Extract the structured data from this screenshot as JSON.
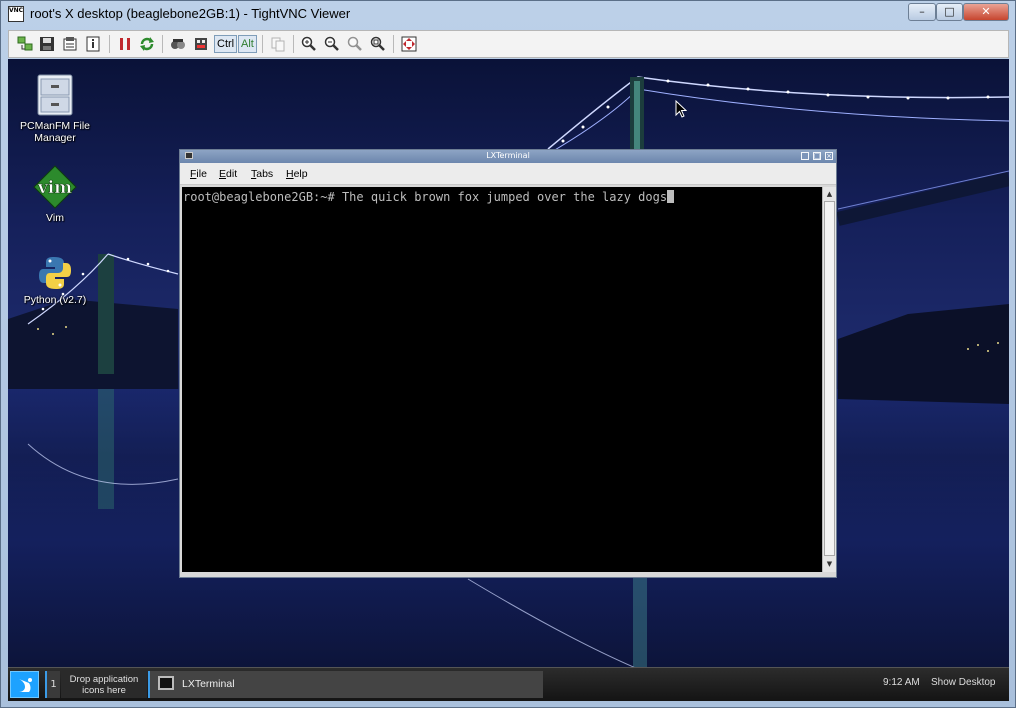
{
  "vnc": {
    "title": "root's X desktop (beaglebone2GB:1) - TightVNC Viewer",
    "app_icon_text": "VNC",
    "window_buttons": {
      "minimize": "–",
      "maximize": "□",
      "close": "✕"
    },
    "toolbar": {
      "icons": [
        "new-connection-icon",
        "save-icon",
        "options-icon",
        "info-icon",
        "pause-icon",
        "refresh-icon",
        "transfer-icon",
        "ctrl-alt-del-icon",
        "copy-icon",
        "zoom-in-icon",
        "zoom-out-icon",
        "zoom-100-icon",
        "zoom-fit-icon",
        "fullscreen-icon"
      ],
      "ctrl_label": "Ctrl",
      "alt_label": "Alt"
    }
  },
  "desktop": {
    "icons": [
      {
        "label": "PCManFM File Manager",
        "icon": "file-cabinet-icon"
      },
      {
        "label": "Vim",
        "icon": "vim-icon"
      },
      {
        "label": "Python (v2.7)",
        "icon": "python-icon"
      }
    ]
  },
  "lxterminal": {
    "title": "LXTerminal",
    "menu": [
      {
        "u": "F",
        "rest": "ile"
      },
      {
        "u": "E",
        "rest": "dit"
      },
      {
        "u": "T",
        "rest": "abs"
      },
      {
        "u": "H",
        "rest": "elp"
      }
    ],
    "terminal_text": "root@beaglebone2GB:~# The quick brown fox jumped over the lazy dogs"
  },
  "taskbar": {
    "desktop_number": "1",
    "launcher_text_line1": "Drop application",
    "launcher_text_line2": "icons here",
    "task_label": "LXTerminal",
    "clock": "9:12 AM",
    "show_desktop": "Show Desktop"
  },
  "colors": {
    "desktop_night": "#1d2a6b",
    "taskbar": "#1c1c1c",
    "start_button": "#1da2ff",
    "terminal_bg": "#000000",
    "terminal_fg": "#bdbdbd"
  }
}
